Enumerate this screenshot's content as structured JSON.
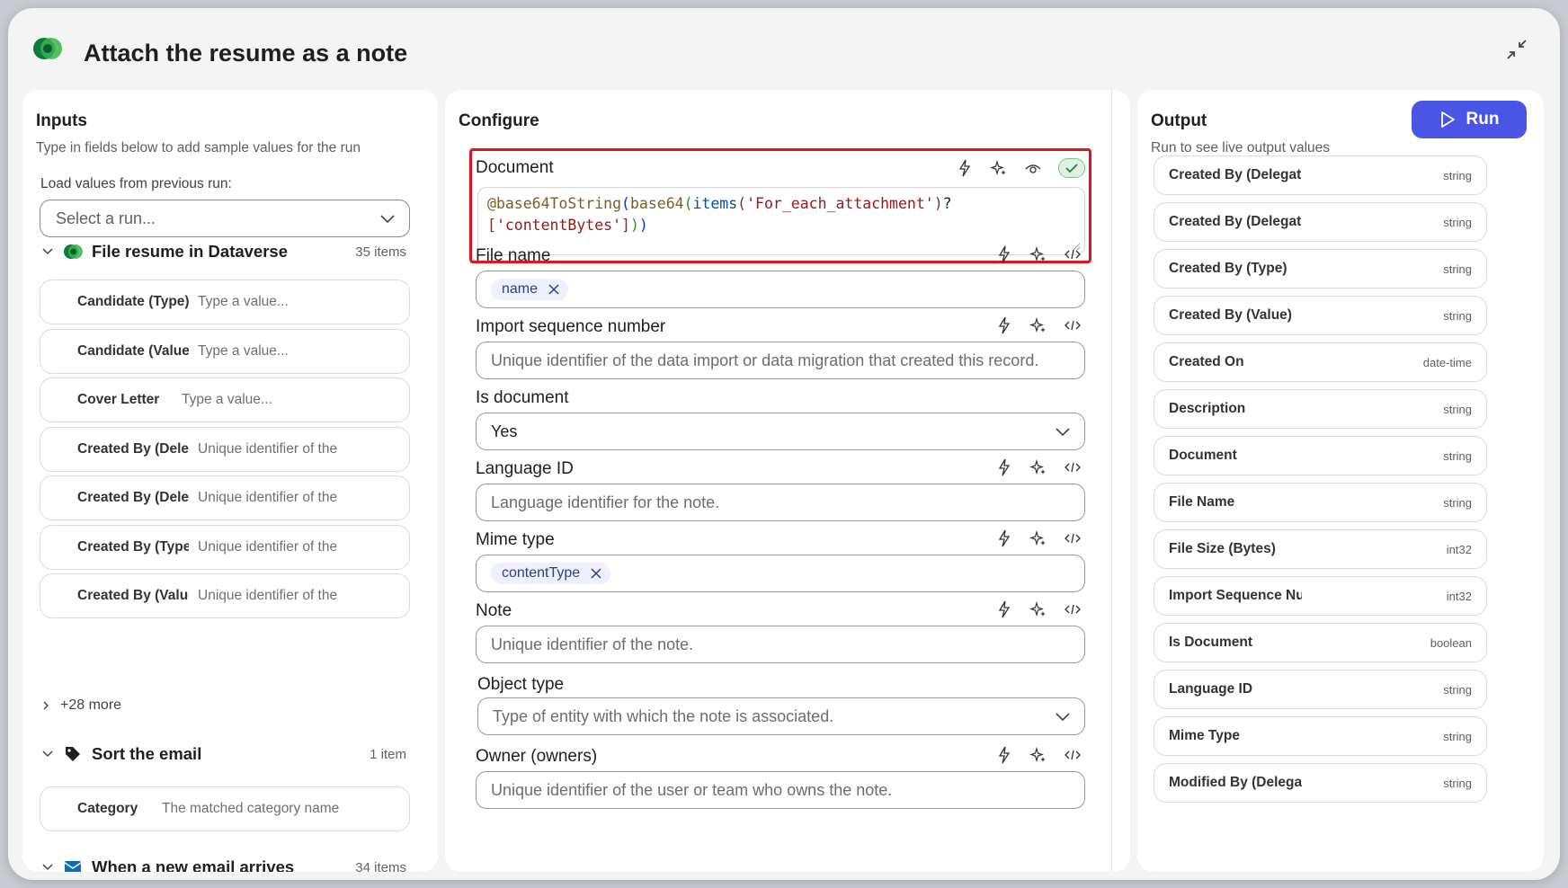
{
  "dialog": {
    "title": "Attach the resume as a note"
  },
  "inputs": {
    "title": "Inputs",
    "subtitle": "Type in fields below to add sample values for the run",
    "load_label": "Load values from previous run:",
    "select_placeholder": "Select a run...",
    "sections": [
      {
        "name": "File resume in Dataverse",
        "count": "35 items",
        "icon": "dataverse-icon",
        "fields": [
          {
            "label": "Candidate (Type)",
            "value": "Type a value..."
          },
          {
            "label": "Candidate (Value)",
            "value": "Type a value..."
          },
          {
            "label": "Cover Letter",
            "value": "Type a value..."
          },
          {
            "label": "Created By (Delegate)",
            "value": "Unique identifier of the"
          },
          {
            "label": "Created By (Delegate)",
            "value": "Unique identifier of the"
          },
          {
            "label": "Created By (Type)",
            "value": "Unique identifier of the"
          },
          {
            "label": "Created By (Value)",
            "value": "Unique identifier of the"
          }
        ],
        "more": "+28 more"
      },
      {
        "name": "Sort the email",
        "count": "1 item",
        "icon": "tag-icon",
        "fields": [
          {
            "label": "Category",
            "value": "The matched category name"
          }
        ]
      },
      {
        "name": "When a new email arrives",
        "count": "34 items",
        "icon": "outlook-icon"
      }
    ]
  },
  "configure": {
    "title": "Configure",
    "document": {
      "label": "Document",
      "code_tokens": {
        "at": "@",
        "fn1": "base64ToString",
        "p1o": "(",
        "fn2": "base64",
        "p2o": "(",
        "fn3": "items",
        "p3o": "(",
        "s1": "'For_each_attachment'",
        "p3c": ")",
        "q": "?",
        "b1": "[",
        "s2": "'contentBytes'",
        "b2": "]",
        "p2c": ")",
        "p1c": ")"
      }
    },
    "file_name": {
      "label": "File name",
      "chip": "name"
    },
    "import_seq": {
      "label": "Import sequence number",
      "placeholder": "Unique identifier of the data import or data migration that created this record."
    },
    "is_document": {
      "label": "Is document",
      "value": "Yes"
    },
    "language_id": {
      "label": "Language ID",
      "placeholder": "Language identifier for the note."
    },
    "mime_type": {
      "label": "Mime type",
      "chip": "contentType"
    },
    "note": {
      "label": "Note",
      "placeholder": "Unique identifier of the note."
    },
    "object_type": {
      "label": "Object type",
      "placeholder": "Type of entity with which the note is associated."
    },
    "owner": {
      "label": "Owner (owners)",
      "placeholder": "Unique identifier of the user or team who owns the note."
    }
  },
  "output": {
    "title": "Output",
    "subtitle": "Run to see live output values",
    "run_label": "Run",
    "rows": [
      {
        "name": "Created By (Delegate)",
        "type": "string"
      },
      {
        "name": "Created By (Delegate)",
        "type": "string"
      },
      {
        "name": "Created By (Type)",
        "type": "string"
      },
      {
        "name": "Created By (Value)",
        "type": "string"
      },
      {
        "name": "Created On",
        "type": "date-time"
      },
      {
        "name": "Description",
        "type": "string"
      },
      {
        "name": "Document",
        "type": "string"
      },
      {
        "name": "File Name",
        "type": "string"
      },
      {
        "name": "File Size (Bytes)",
        "type": "int32"
      },
      {
        "name": "Import Sequence Number",
        "type": "int32"
      },
      {
        "name": "Is Document",
        "type": "boolean"
      },
      {
        "name": "Language ID",
        "type": "string"
      },
      {
        "name": "Mime Type",
        "type": "string"
      },
      {
        "name": "Modified By (Delegate)",
        "type": "string"
      }
    ]
  },
  "colors": {
    "accent": "#4a55e6",
    "highlight_border": "#e0141e",
    "chip_bg": "#eef0fb"
  }
}
